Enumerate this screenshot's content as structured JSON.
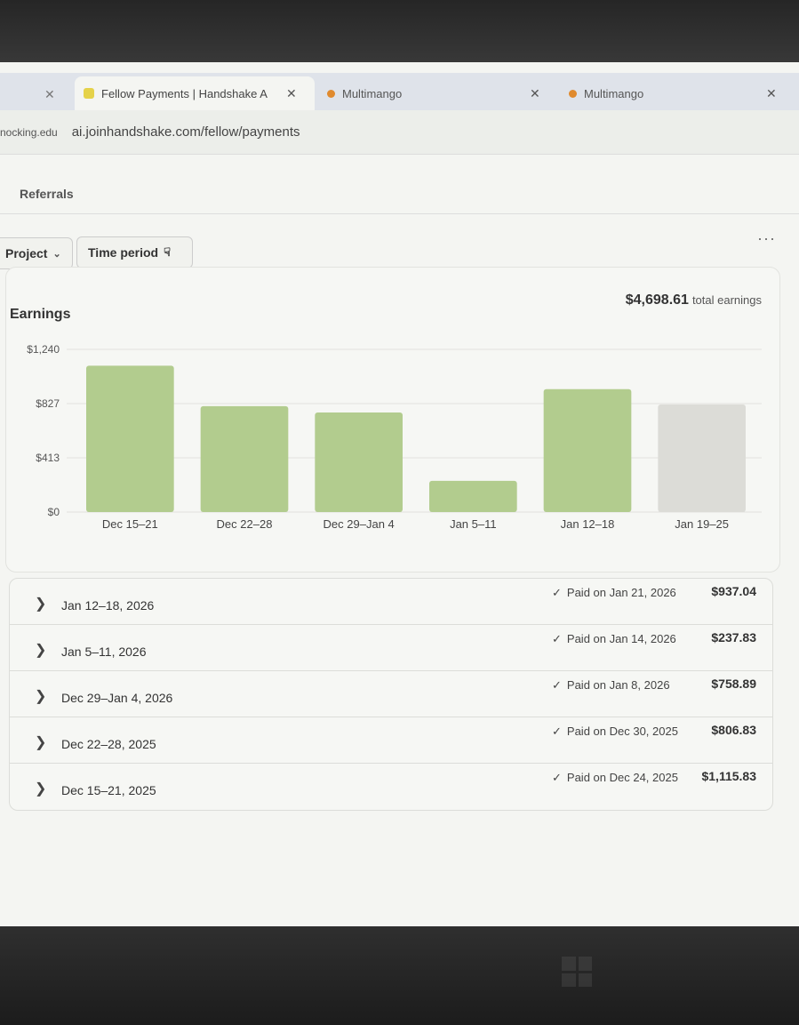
{
  "browser": {
    "tabs": [
      {
        "title": "Fellow Payments | Handshake A",
        "active": true,
        "close": "✕"
      },
      {
        "title": "Multimango",
        "active": false,
        "close": "✕"
      },
      {
        "title": "Multimango",
        "active": false,
        "close": "✕"
      }
    ],
    "left_close": "✕",
    "address_prefix": "nocking.edu",
    "url": "ai.joinhandshake.com/fellow/payments"
  },
  "nav": {
    "referrals": "Referrals"
  },
  "filters": {
    "project": "Project",
    "time_period": "Time period"
  },
  "summary": {
    "title": "Earnings",
    "total": "$4,698.61",
    "total_label": "total earnings"
  },
  "chart_data": {
    "type": "bar",
    "categories": [
      "Dec 15–21",
      "Dec 22–28",
      "Dec 29–Jan 4",
      "Jan 5–11",
      "Jan 12–18",
      "Jan 19–25"
    ],
    "values": [
      1115.83,
      806.83,
      758.89,
      237.83,
      937.04,
      820
    ],
    "pending": [
      false,
      false,
      false,
      false,
      false,
      true
    ],
    "yticks": [
      "$1,240",
      "$827",
      "$413",
      "$0"
    ],
    "ylim": [
      0,
      1240
    ],
    "colors": {
      "paid": "#b2cc8e",
      "pending": "#dcdcd7"
    },
    "grid": true
  },
  "payments": [
    {
      "period": "Jan 12–18, 2026",
      "status": "Paid on Jan 21, 2026",
      "amount": "$937.04"
    },
    {
      "period": "Jan 5–11, 2026",
      "status": "Paid on Jan 14, 2026",
      "amount": "$237.83"
    },
    {
      "period": "Dec 29–Jan 4, 2026",
      "status": "Paid on Jan 8, 2026",
      "amount": "$758.89"
    },
    {
      "period": "Dec 22–28, 2025",
      "status": "Paid on Dec 30, 2025",
      "amount": "$806.83"
    },
    {
      "period": "Dec 15–21, 2025",
      "status": "Paid on Dec 24, 2025",
      "amount": "$1,115.83"
    }
  ]
}
